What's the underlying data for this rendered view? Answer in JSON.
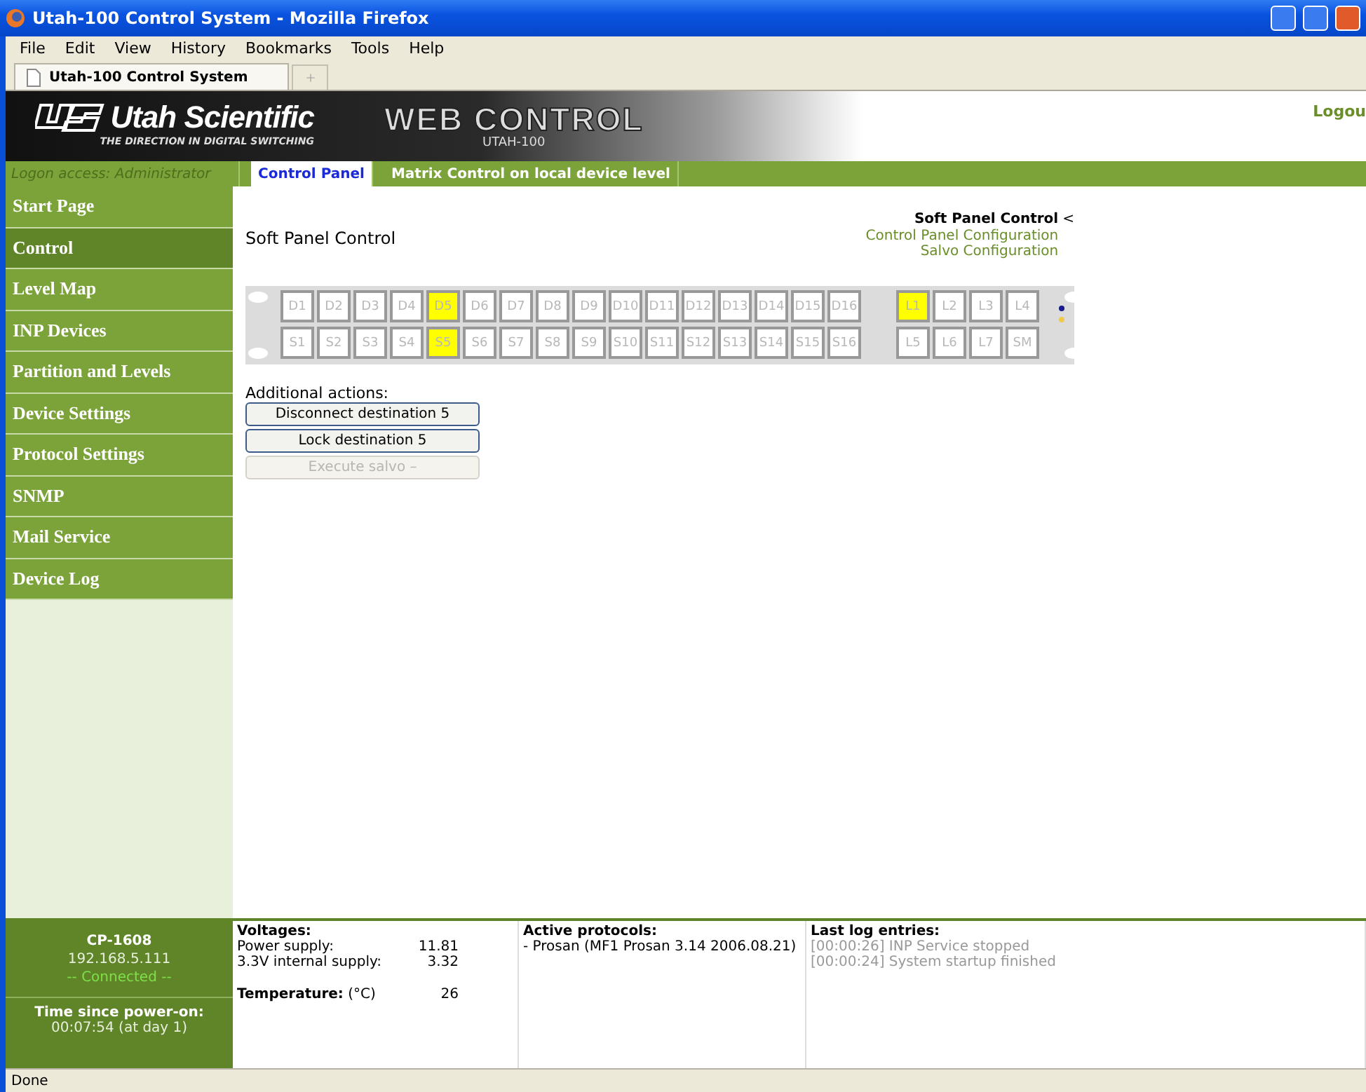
{
  "browser": {
    "title": "Utah-100 Control System - Mozilla Firefox",
    "menu": [
      "File",
      "Edit",
      "View",
      "History",
      "Bookmarks",
      "Tools",
      "Help"
    ],
    "tab": {
      "title": "Utah-100 Control System"
    },
    "status": "Done"
  },
  "header": {
    "brand": "Utah Scientific",
    "tagline": "THE DIRECTION IN DIGITAL SWITCHING",
    "product": "WEB CONTROL",
    "model": "UTAH-100",
    "logout": "Logou"
  },
  "nav": {
    "logon": "Logon access: Administrator",
    "tabs": [
      {
        "label": "Control Panel",
        "selected": true
      },
      {
        "label": "Matrix Control on local device level",
        "selected": false
      }
    ]
  },
  "sidebar": {
    "items": [
      {
        "label": "Start Page",
        "selected": false
      },
      {
        "label": "Control",
        "selected": true
      },
      {
        "label": "Level Map",
        "selected": false
      },
      {
        "label": "INP Devices",
        "selected": false
      },
      {
        "label": "Partition and Levels",
        "selected": false
      },
      {
        "label": "Device Settings",
        "selected": false
      },
      {
        "label": "Protocol Settings",
        "selected": false
      },
      {
        "label": "SNMP",
        "selected": false
      },
      {
        "label": "Mail Service",
        "selected": false
      },
      {
        "label": "Device Log",
        "selected": false
      }
    ]
  },
  "content": {
    "title": "Soft Panel Control",
    "current_marker": "<",
    "links": [
      {
        "label": "Soft Panel Control",
        "selected": true
      },
      {
        "label": "Control Panel Configuration",
        "selected": false
      },
      {
        "label": "Salvo Configuration",
        "selected": false
      }
    ],
    "panel": {
      "destinations": [
        {
          "label": "D1",
          "selected": false
        },
        {
          "label": "D2",
          "selected": false
        },
        {
          "label": "D3",
          "selected": false
        },
        {
          "label": "D4",
          "selected": false
        },
        {
          "label": "D5",
          "selected": true
        },
        {
          "label": "D6",
          "selected": false
        },
        {
          "label": "D7",
          "selected": false
        },
        {
          "label": "D8",
          "selected": false
        },
        {
          "label": "D9",
          "selected": false
        },
        {
          "label": "D10",
          "selected": false
        },
        {
          "label": "D11",
          "selected": false
        },
        {
          "label": "D12",
          "selected": false
        },
        {
          "label": "D13",
          "selected": false
        },
        {
          "label": "D14",
          "selected": false
        },
        {
          "label": "D15",
          "selected": false
        },
        {
          "label": "D16",
          "selected": false
        }
      ],
      "sources": [
        {
          "label": "S1",
          "selected": false
        },
        {
          "label": "S2",
          "selected": false
        },
        {
          "label": "S3",
          "selected": false
        },
        {
          "label": "S4",
          "selected": false
        },
        {
          "label": "S5",
          "selected": true
        },
        {
          "label": "S6",
          "selected": false
        },
        {
          "label": "S7",
          "selected": false
        },
        {
          "label": "S8",
          "selected": false
        },
        {
          "label": "S9",
          "selected": false
        },
        {
          "label": "S10",
          "selected": false
        },
        {
          "label": "S11",
          "selected": false
        },
        {
          "label": "S12",
          "selected": false
        },
        {
          "label": "S13",
          "selected": false
        },
        {
          "label": "S14",
          "selected": false
        },
        {
          "label": "S15",
          "selected": false
        },
        {
          "label": "S16",
          "selected": false
        }
      ],
      "levels_top": [
        {
          "label": "L1",
          "selected": true
        },
        {
          "label": "L2",
          "selected": false
        },
        {
          "label": "L3",
          "selected": false
        },
        {
          "label": "L4",
          "selected": false
        }
      ],
      "levels_bottom": [
        {
          "label": "L5",
          "selected": false
        },
        {
          "label": "L6",
          "selected": false
        },
        {
          "label": "L7",
          "selected": false
        },
        {
          "label": "SM",
          "selected": false
        }
      ],
      "indicators": [
        {
          "color": "#1a1a8c"
        },
        {
          "color": "#f0c850"
        }
      ]
    },
    "actions": {
      "label": "Additional actions:",
      "buttons": [
        {
          "label": "Disconnect destination 5",
          "disabled": false
        },
        {
          "label": "Lock destination 5",
          "disabled": false
        },
        {
          "label": "Execute salvo –",
          "disabled": true
        }
      ]
    }
  },
  "footer": {
    "device": {
      "name": "CP-1608",
      "ip": "192.168.5.111",
      "status": "-- Connected --",
      "uptime_label": "Time since power-on:",
      "uptime": "00:07:54 (at day 1)"
    },
    "voltages": {
      "title": "Voltages:",
      "rows": [
        {
          "label": "Power supply:",
          "value": "11.81"
        },
        {
          "label": "3.3V internal supply:",
          "value": "3.32"
        }
      ],
      "temperature": {
        "label": "Temperature:",
        "unit": "(°C)",
        "value": "26"
      }
    },
    "protocols": {
      "title": "Active protocols:",
      "items": [
        "- Prosan (MF1 Prosan 3.14 2006.08.21)"
      ]
    },
    "log": {
      "title": "Last log entries:",
      "entries": [
        "[00:00:26] INP Service stopped",
        "[00:00:24] System startup finished"
      ]
    }
  }
}
